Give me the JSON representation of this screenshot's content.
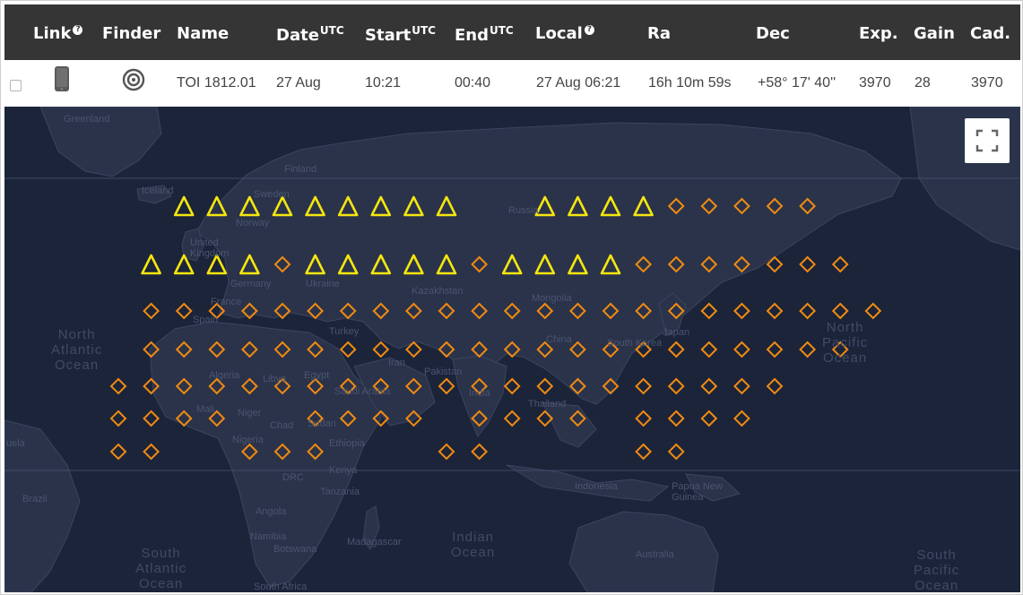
{
  "table": {
    "headers": {
      "link": "Link",
      "finder": "Finder",
      "name": "Name",
      "date": "Date",
      "date_sup": "UTC",
      "start": "Start",
      "start_sup": "UTC",
      "end": "End",
      "end_sup": "UTC",
      "local": "Local",
      "ra": "Ra",
      "dec": "Dec",
      "exp": "Exp.",
      "gain": "Gain",
      "cad": "Cad."
    },
    "help_glyph": "?",
    "row": {
      "name": "TOI 1812.01",
      "date": "27 Aug",
      "start": "10:21",
      "end": "00:40",
      "local": "27 Aug 06:21",
      "ra": "16h 10m 59s",
      "dec": "+58° 17' 40''",
      "exp": "3970",
      "gain": "28",
      "cad": "3970"
    }
  },
  "icons": {
    "link": "phone-icon",
    "finder": "target-icon",
    "fullscreen": "fullscreen-icon"
  },
  "map": {
    "labels": {
      "greenland": "Greenland",
      "iceland": "Iceland",
      "finland": "Finland",
      "sweden": "Sweden",
      "norway": "Norway",
      "russia": "Russia",
      "uk": "United\nKingdom",
      "germany": "Germany",
      "ukraine": "Ukraine",
      "kazakhstan": "Kazakhstan",
      "mongolia": "Mongolia",
      "france": "France",
      "spain": "Spain",
      "turkey": "Turkey",
      "china": "China",
      "south_korea": "South Korea",
      "japan": "Japan",
      "iran": "Iran",
      "pakistan": "Pakistan",
      "algeria": "Algeria",
      "libya": "Libya",
      "egypt": "Egypt",
      "saudi": "Saudi Arabia",
      "india": "India",
      "thailand": "Thailand",
      "mali": "Mali",
      "niger": "Niger",
      "chad": "Chad",
      "sudan": "Sudan",
      "nigeria": "Nigeria",
      "ethiopia": "Ethiopia",
      "drc": "DRC",
      "kenya": "Kenya",
      "tanzania": "Tanzania",
      "indonesia": "Indonesia",
      "png": "Papua New\nGuinea",
      "angola": "Angola",
      "namibia": "Namibia",
      "botswana": "Botswana",
      "madagascar": "Madagascar",
      "australia": "Australia",
      "brazil": "Brazil",
      "south_africa": "South Africa",
      "bolivia": "uela"
    },
    "oceans": {
      "north_atlantic": "North\nAtlantic\nOcean",
      "north_pacific": "North\nPacific\nOcean",
      "south_atlantic": "South\nAtlantic\nOcean",
      "indian": "Indian\nOcean",
      "south_pacific": "South\nPacific\nOcean"
    },
    "colors": {
      "background": "#1b2439",
      "triangle": "#f5e60f",
      "diamond": "#f08a12"
    },
    "markers": {
      "triangles": [
        [
          1,
          2
        ],
        [
          1,
          3
        ],
        [
          1,
          4
        ],
        [
          1,
          5
        ],
        [
          1,
          6
        ],
        [
          1,
          7
        ],
        [
          1,
          8
        ],
        [
          1,
          9
        ],
        [
          1,
          10
        ],
        [
          1,
          13
        ],
        [
          1,
          14
        ],
        [
          1,
          15
        ],
        [
          1,
          16
        ],
        [
          2,
          1
        ],
        [
          2,
          2
        ],
        [
          2,
          3
        ],
        [
          2,
          4
        ],
        [
          2,
          6
        ],
        [
          2,
          7
        ],
        [
          2,
          8
        ],
        [
          2,
          9
        ],
        [
          2,
          10
        ],
        [
          2,
          12
        ],
        [
          2,
          13
        ],
        [
          2,
          14
        ],
        [
          2,
          15
        ]
      ],
      "diamonds": [
        [
          1,
          17
        ],
        [
          1,
          18
        ],
        [
          1,
          19
        ],
        [
          1,
          20
        ],
        [
          1,
          21
        ],
        [
          2,
          5
        ],
        [
          2,
          11
        ],
        [
          2,
          16
        ],
        [
          2,
          17
        ],
        [
          2,
          18
        ],
        [
          2,
          19
        ],
        [
          2,
          20
        ],
        [
          2,
          21
        ],
        [
          2,
          22
        ],
        [
          3,
          1
        ],
        [
          3,
          2
        ],
        [
          3,
          3
        ],
        [
          3,
          4
        ],
        [
          3,
          5
        ],
        [
          3,
          6
        ],
        [
          3,
          7
        ],
        [
          3,
          8
        ],
        [
          3,
          9
        ],
        [
          3,
          10
        ],
        [
          3,
          11
        ],
        [
          3,
          12
        ],
        [
          3,
          13
        ],
        [
          3,
          14
        ],
        [
          3,
          15
        ],
        [
          3,
          16
        ],
        [
          3,
          17
        ],
        [
          3,
          18
        ],
        [
          3,
          19
        ],
        [
          3,
          20
        ],
        [
          3,
          21
        ],
        [
          3,
          22
        ],
        [
          3,
          23
        ],
        [
          4,
          1
        ],
        [
          4,
          2
        ],
        [
          4,
          3
        ],
        [
          4,
          4
        ],
        [
          4,
          5
        ],
        [
          4,
          6
        ],
        [
          4,
          7
        ],
        [
          4,
          8
        ],
        [
          4,
          9
        ],
        [
          4,
          10
        ],
        [
          4,
          11
        ],
        [
          4,
          12
        ],
        [
          4,
          13
        ],
        [
          4,
          14
        ],
        [
          4,
          15
        ],
        [
          4,
          16
        ],
        [
          4,
          17
        ],
        [
          4,
          18
        ],
        [
          4,
          19
        ],
        [
          4,
          20
        ],
        [
          4,
          21
        ],
        [
          4,
          22
        ],
        [
          5,
          0
        ],
        [
          5,
          1
        ],
        [
          5,
          2
        ],
        [
          5,
          3
        ],
        [
          5,
          4
        ],
        [
          5,
          5
        ],
        [
          5,
          6
        ],
        [
          5,
          7
        ],
        [
          5,
          8
        ],
        [
          5,
          9
        ],
        [
          5,
          10
        ],
        [
          5,
          11
        ],
        [
          5,
          12
        ],
        [
          5,
          13
        ],
        [
          5,
          14
        ],
        [
          5,
          15
        ],
        [
          5,
          16
        ],
        [
          5,
          17
        ],
        [
          5,
          18
        ],
        [
          5,
          19
        ],
        [
          5,
          20
        ],
        [
          6,
          0
        ],
        [
          6,
          1
        ],
        [
          6,
          2
        ],
        [
          6,
          3
        ],
        [
          6,
          6
        ],
        [
          6,
          7
        ],
        [
          6,
          8
        ],
        [
          6,
          9
        ],
        [
          6,
          11
        ],
        [
          6,
          12
        ],
        [
          6,
          13
        ],
        [
          6,
          14
        ],
        [
          6,
          16
        ],
        [
          6,
          17
        ],
        [
          6,
          18
        ],
        [
          6,
          19
        ],
        [
          7,
          0
        ],
        [
          7,
          1
        ],
        [
          7,
          4
        ],
        [
          7,
          5
        ],
        [
          7,
          6
        ],
        [
          7,
          10
        ],
        [
          7,
          11
        ],
        [
          7,
          16
        ],
        [
          7,
          17
        ]
      ]
    }
  }
}
